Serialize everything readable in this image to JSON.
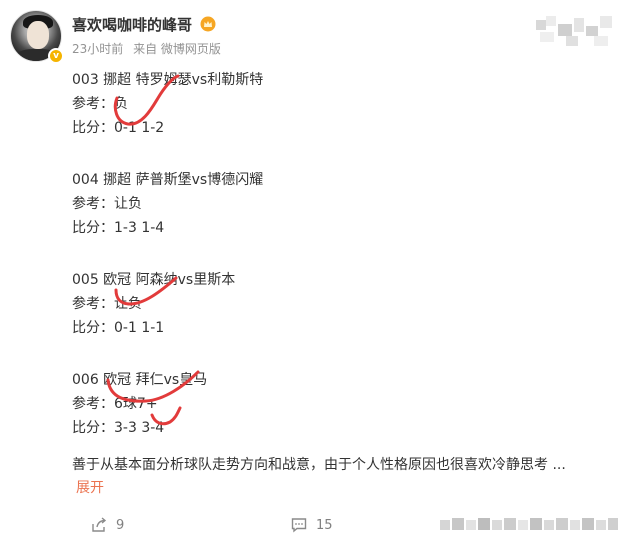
{
  "author": {
    "name": "喜欢喝咖啡的峰哥",
    "time": "23小时前",
    "source": "来自 微博网页版",
    "avatar_icon": "avatar-photo",
    "badge_icon": "verified-badge-icon",
    "crown_icon": "crown-icon"
  },
  "matches": [
    {
      "title": "003 挪超 特罗姆瑟vs利勒斯特",
      "ref": "参考：负",
      "score": "比分：0-1 1-2"
    },
    {
      "title": "004 挪超 萨普斯堡vs博德闪耀",
      "ref": "参考：让负",
      "score": "比分：1-3 1-4"
    },
    {
      "title": "005 欧冠 阿森纳vs里斯本",
      "ref": "参考：让负",
      "score": "比分：0-1 1-1"
    },
    {
      "title": "006 欧冠 拜仁vs皇马",
      "ref": "参考：6球7+",
      "score": "比分：3-3 3-4"
    }
  ],
  "summary": "善于从基本面分析球队走势方向和战意，由于个人性格原因也很喜欢冷静思考  ...",
  "expand_label": "展开",
  "actions": {
    "share_count": "9",
    "comment_count": "15"
  },
  "colors": {
    "accent_link": "#eb7350",
    "marks": "#e23b3b",
    "meta": "#939393"
  }
}
